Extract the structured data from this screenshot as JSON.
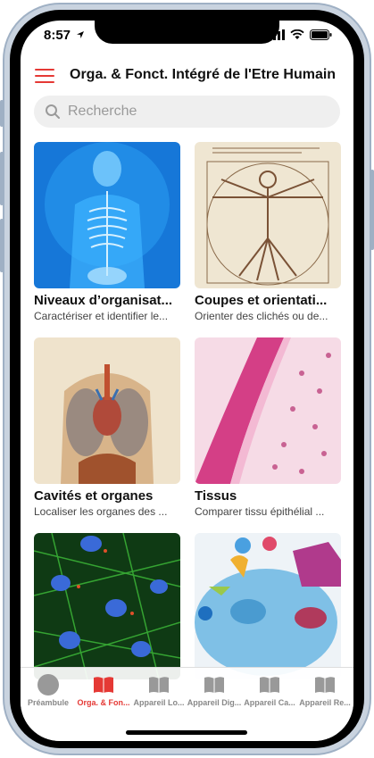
{
  "status": {
    "time": "8:57"
  },
  "header": {
    "title": "Orga. & Fonct. Intégré de l'Etre Humain"
  },
  "search": {
    "placeholder": "Recherche"
  },
  "cards": [
    {
      "title": "Niveaux d’organisat...",
      "subtitle": "Caractériser et identifier le..."
    },
    {
      "title": "Coupes et orientati...",
      "subtitle": "Orienter des clichés ou de..."
    },
    {
      "title": "Cavités et organes",
      "subtitle": "Localiser les organes des ..."
    },
    {
      "title": "Tissus",
      "subtitle": "Comparer tissu épithélial ..."
    },
    {
      "title": "",
      "subtitle": ""
    },
    {
      "title": "",
      "subtitle": ""
    }
  ],
  "tabs": [
    {
      "label": "Préambule",
      "active": false
    },
    {
      "label": "Orga. & Fon...",
      "active": true
    },
    {
      "label": "Appareil Lo...",
      "active": false
    },
    {
      "label": "Appareil Dig...",
      "active": false
    },
    {
      "label": "Appareil Ca...",
      "active": false
    },
    {
      "label": "Appareil Re...",
      "active": false
    }
  ],
  "colors": {
    "accent": "#e53935",
    "inactive": "#888888"
  },
  "icons": {
    "menu": "hamburger-icon",
    "search": "search-icon",
    "tab0": "circle-icon",
    "tab_other": "book-icon",
    "status": [
      "location-arrow-icon",
      "signal-icon",
      "wifi-icon",
      "battery-icon"
    ]
  }
}
